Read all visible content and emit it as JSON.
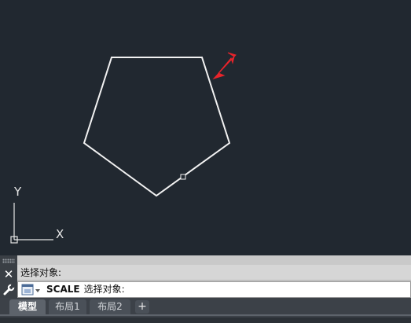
{
  "viewport": {
    "background": "#212830",
    "shape_color": "#f2f2f2",
    "arrow_color": "#e8242b",
    "ucs": {
      "x_label": "X",
      "y_label": "Y"
    }
  },
  "command_line": {
    "history": "选择对象:",
    "command": "SCALE",
    "prompt": "选择对象:",
    "close_glyph": "✕"
  },
  "tabs": [
    {
      "label": "模型",
      "active": true
    },
    {
      "label": "布局1",
      "active": false
    },
    {
      "label": "布局2",
      "active": false
    }
  ],
  "add_tab_glyph": "+"
}
